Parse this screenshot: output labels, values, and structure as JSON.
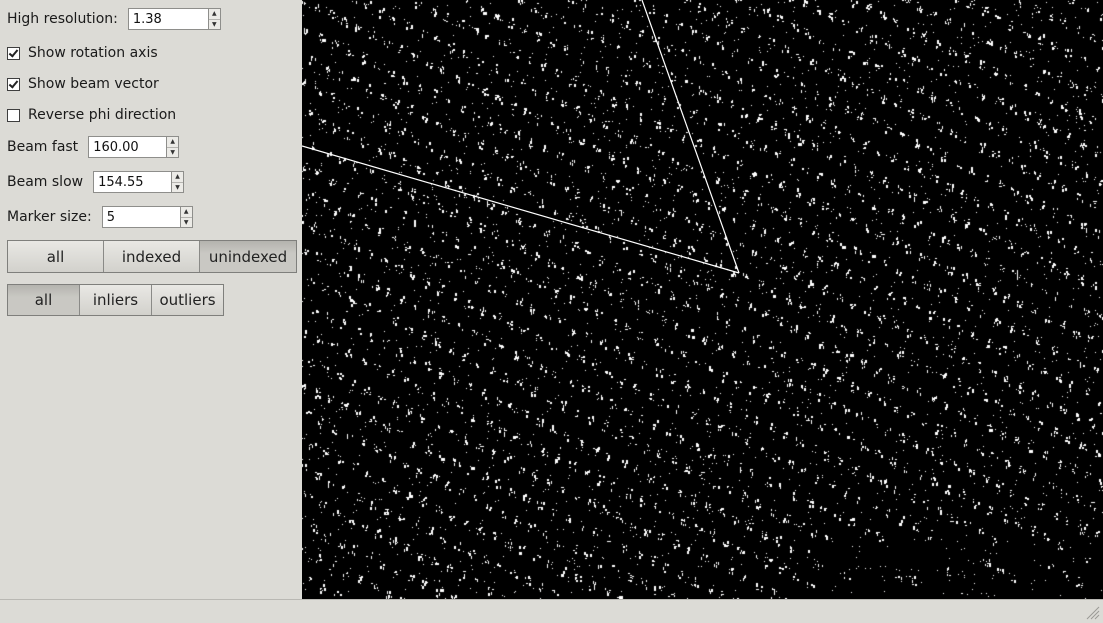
{
  "sidebar": {
    "high_resolution": {
      "label": "High resolution:",
      "value": "1.38"
    },
    "show_rotation_axis": {
      "label": "Show rotation axis",
      "checked": true
    },
    "show_beam_vector": {
      "label": "Show beam vector",
      "checked": true
    },
    "reverse_phi": {
      "label": "Reverse phi direction",
      "checked": false
    },
    "beam_fast": {
      "label": "Beam fast",
      "value": "160.00"
    },
    "beam_slow": {
      "label": "Beam slow",
      "value": "154.55"
    },
    "marker_size": {
      "label": "Marker size:",
      "value": "5"
    },
    "index_filter": {
      "options": [
        "all",
        "indexed",
        "unindexed"
      ],
      "selected": "unindexed"
    },
    "outlier_filter": {
      "options": [
        "all",
        "inliers",
        "outliers"
      ],
      "selected": "all"
    }
  },
  "viewer": {
    "background": "#000000",
    "spot_color": "#ffffff",
    "line_color": "#ffffff"
  },
  "colors": {
    "panel": "#dcdbd6",
    "button_active": "#c0bfba"
  }
}
